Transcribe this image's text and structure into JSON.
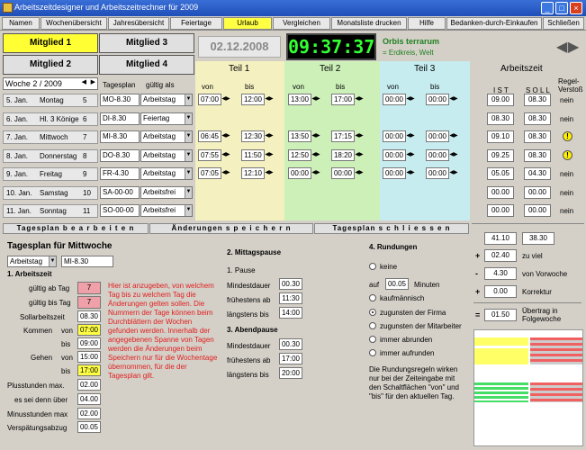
{
  "window": {
    "title": "Arbeitszeitdesigner und Arbeitszeitrechner für 2009",
    "min": "_",
    "max": "□",
    "close": "×"
  },
  "menu": [
    "Namen",
    "Wochenübersicht",
    "Jahresübersicht",
    "Feiertage",
    "Urlaub",
    "Vergleichen",
    "Monatsliste drucken",
    "Hilfe",
    "Bedanken-durch-Einkaufen",
    "Schließen"
  ],
  "members": [
    "Mitglied 1",
    "Mitglied 3",
    "Mitglied 2",
    "Mitglied 4"
  ],
  "date": "02.12.2008",
  "clock": "09:37:37",
  "org": {
    "name": "Orbis terrarum",
    "sub": "= Erdkreis, Welt"
  },
  "week": {
    "label": "Woche  2 / 2009",
    "tagesplan": "Tagesplan",
    "gueltig": "gültig als"
  },
  "teile": [
    "Teil 1",
    "Teil 2",
    "Teil 3"
  ],
  "von": "von",
  "bis": "bis",
  "az": {
    "title": "Arbeitszeit",
    "ist": "I S T",
    "soll": "S O L L",
    "regel": "Regel-Verstoß"
  },
  "days": [
    {
      "date": "5. Jan.",
      "name": "Montag",
      "num": "5",
      "plan": "MO-8.30",
      "type": "Arbeitstag",
      "t1v": "07:00",
      "t1b": "12:00",
      "t2v": "13:00",
      "t2b": "17:00",
      "t3v": "00:00",
      "t3b": "00:00",
      "ist": "09.00",
      "soll": "08.30",
      "rv": "nein"
    },
    {
      "date": "6. Jan.",
      "name": "Hl. 3 Könige",
      "num": "6",
      "plan": "DI-8.30",
      "type": "Feiertag",
      "t1v": "",
      "t1b": "",
      "t2v": "",
      "t2b": "",
      "t3v": "",
      "t3b": "",
      "ist": "08.30",
      "soll": "08.30",
      "rv": "nein"
    },
    {
      "date": "7. Jan.",
      "name": "Mittwoch",
      "num": "7",
      "plan": "MI-8.30",
      "type": "Arbeitstag",
      "t1v": "06:45",
      "t1b": "12:30",
      "t2v": "13:50",
      "t2b": "17:15",
      "t3v": "00:00",
      "t3b": "00:00",
      "ist": "09.10",
      "soll": "08.30",
      "rv": "!"
    },
    {
      "date": "8. Jan.",
      "name": "Donnerstag",
      "num": "8",
      "plan": "DO-8.30",
      "type": "Arbeitstag",
      "t1v": "07:55",
      "t1b": "11:50",
      "t2v": "12:50",
      "t2b": "18:20",
      "t3v": "00:00",
      "t3b": "00:00",
      "ist": "09.25",
      "soll": "08.30",
      "rv": "!"
    },
    {
      "date": "9. Jan.",
      "name": "Freitag",
      "num": "9",
      "plan": "FR-4.30",
      "type": "Arbeitstag",
      "t1v": "07:05",
      "t1b": "12:10",
      "t2v": "00:00",
      "t2b": "00:00",
      "t3v": "00:00",
      "t3b": "00:00",
      "ist": "05.05",
      "soll": "04.30",
      "rv": "nein"
    },
    {
      "date": "10. Jan.",
      "name": "Samstag",
      "num": "10",
      "plan": "SA-00-00",
      "type": "Arbeitsfrei",
      "t1v": "",
      "t1b": "",
      "t2v": "",
      "t2b": "",
      "t3v": "",
      "t3b": "",
      "ist": "00.00",
      "soll": "00.00",
      "rv": "nein"
    },
    {
      "date": "11. Jan.",
      "name": "Sonntag",
      "num": "11",
      "plan": "SO-00-00",
      "type": "Arbeitsfrei",
      "t1v": "",
      "t1b": "",
      "t2v": "",
      "t2b": "",
      "t3v": "",
      "t3b": "",
      "ist": "00.00",
      "soll": "00.00",
      "rv": "nein"
    }
  ],
  "bar": {
    "edit": "Tagesplan   b e a r b e i t e n",
    "save": "Änderungen   s p e i c h e r n",
    "close": "Tagesplan   s c h l i e s s e n"
  },
  "plan": {
    "title": "Tagesplan für Mittwoche",
    "type": "Arbeitstag",
    "name": "MI-8.30",
    "s1": "1. Arbeitszeit",
    "ab": "gültig ab Tag",
    "ab_v": "7",
    "bisTag": "gültig bis Tag",
    "bis_v": "7",
    "soll": "Sollarbeitszeit",
    "soll_v": "08.30",
    "kommen": "Kommen",
    "von": "von",
    "kv": "07:00",
    "bis": "bis",
    "kb": "09:00",
    "gehen": "Gehen",
    "gv": "15:00",
    "gb": "17:00",
    "plus": "Plusstunden max.",
    "plus_v": "02.00",
    "esseidenn": "es sei denn über",
    "essei_v": "04.00",
    "minus": "Minusstunden max",
    "minus_v": "02.00",
    "versp": "Verspätungsabzug",
    "versp_v": "00.05",
    "info": "Hier ist anzugeben, von welchem Tag bis zu welchem Tag die Änderungen gelten sollen. Die Nummern der Tage können beim Durchblättern der Wochen gefunden werden. Innerhalb der angegebenen Spanne von Tagen werden die Änderungen beim Speichern nur für die Wochentage übernommen, für die der Tagesplan gilt.",
    "s2": "2. Mittagspause",
    "p1": "1. Pause",
    "mind": "Mindestdauer",
    "mind_v": "00.30",
    "frueh": "frühestens ab",
    "frueh_v": "11:30",
    "spaet": "längstens bis",
    "spaet_v": "14:00",
    "s3": "3. Abendpause",
    "mind2_v": "00.30",
    "frueh2_v": "17:00",
    "spaet2_v": "20:00",
    "s4": "4. Rundungen",
    "keine": "keine",
    "auf": "auf",
    "auf_v": "00.05",
    "minuten": "Minuten",
    "kaufm": "kaufmännisch",
    "firma": "zugunsten der Firma",
    "mitarb": "zugunsten der Mitarbeiter",
    "abr": "immer abrunden",
    "aufr": "immer aufrunden",
    "note": "Die Rundungsregeln wirken nur bei der Zeiteingabe mit den Schaltflächen \"von\" und \"bis\"  für den aktuellen Tag."
  },
  "sum": {
    "a": "41.10",
    "b": "38.30",
    "c": "02.40",
    "c_l": "zu viel",
    "d": "4.30",
    "d_l": "von Vorwoche",
    "e": "0.00",
    "e_l": "Korrektur",
    "f": "01.50",
    "f_l": "Übertrag in Folgewoche"
  }
}
